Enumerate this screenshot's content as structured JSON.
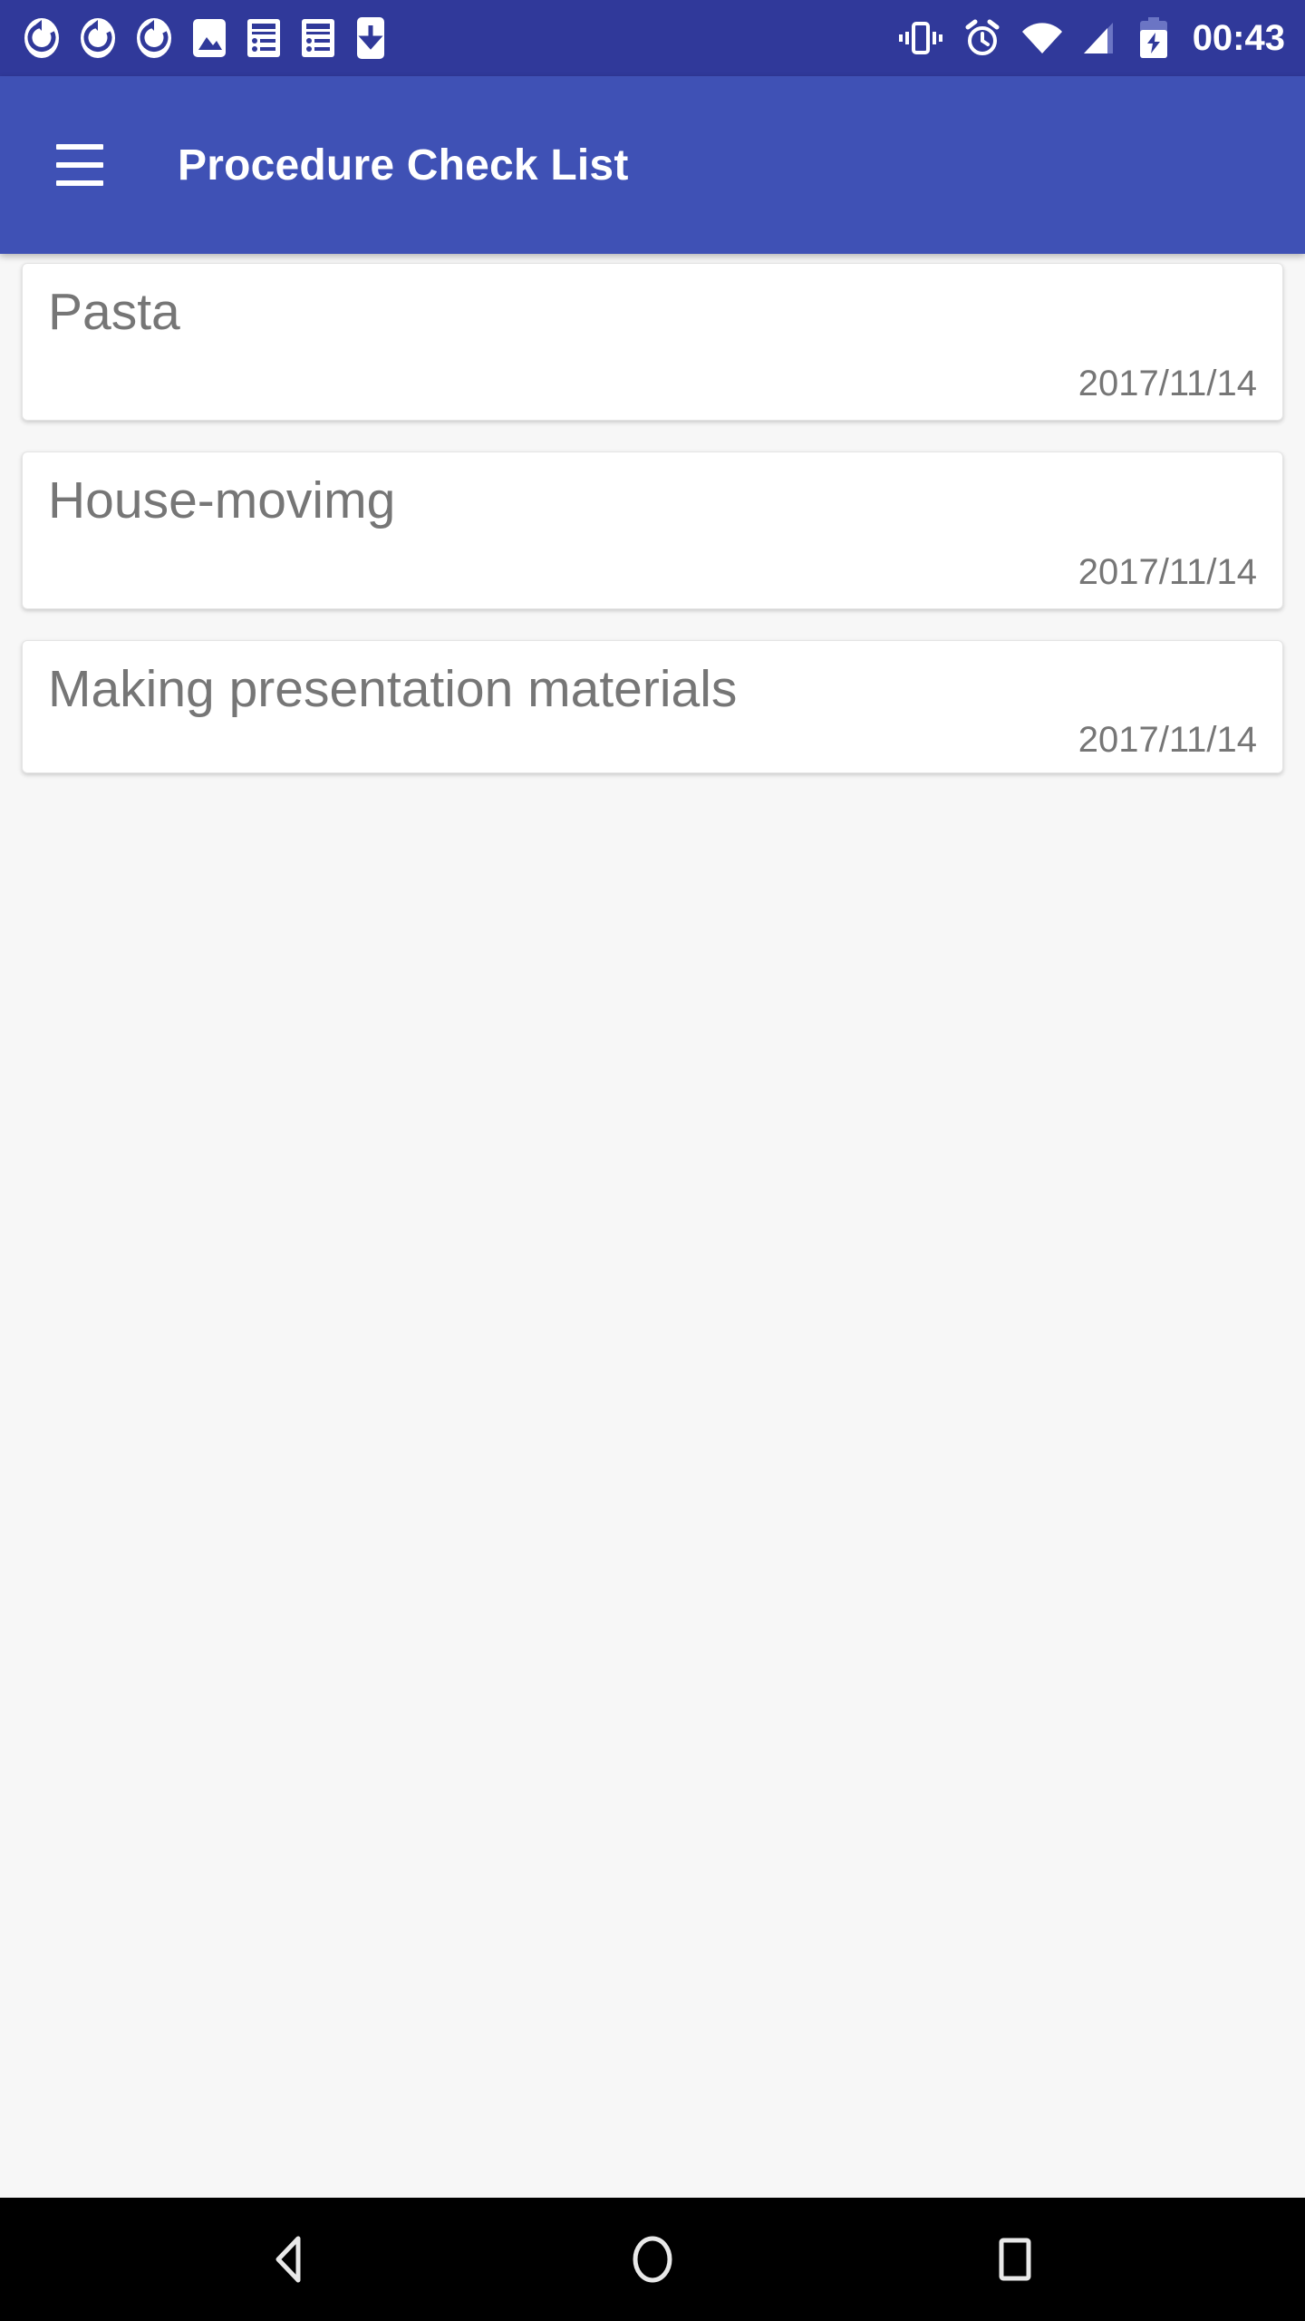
{
  "status_bar": {
    "background": "#30399a",
    "left_icons": [
      "sync-icon",
      "sync-icon",
      "sync-icon",
      "image-icon",
      "article-notification-icon",
      "article-notification-icon",
      "download-to-phone-icon"
    ],
    "right_icons": [
      "vibrate-icon",
      "alarm-icon",
      "wifi-icon",
      "cellular-signal-icon",
      "battery-charging-icon"
    ],
    "clock": "00:43"
  },
  "app_bar": {
    "background": "#3f51b5",
    "menu_icon": "hamburger-menu-icon",
    "title": "Procedure Check List"
  },
  "list": {
    "background": "#f7f7f7",
    "text_color": "#767676",
    "items": [
      {
        "title": "Pasta",
        "date": "2017/11/14"
      },
      {
        "title": "House-movimg",
        "date": "2017/11/14"
      },
      {
        "title": "Making presentation materials",
        "date": "2017/11/14"
      }
    ]
  },
  "nav_bar": {
    "background": "#000000",
    "buttons": [
      {
        "name": "back-icon",
        "label": "Back"
      },
      {
        "name": "home-icon",
        "label": "Home"
      },
      {
        "name": "recents-icon",
        "label": "Recents"
      }
    ]
  }
}
